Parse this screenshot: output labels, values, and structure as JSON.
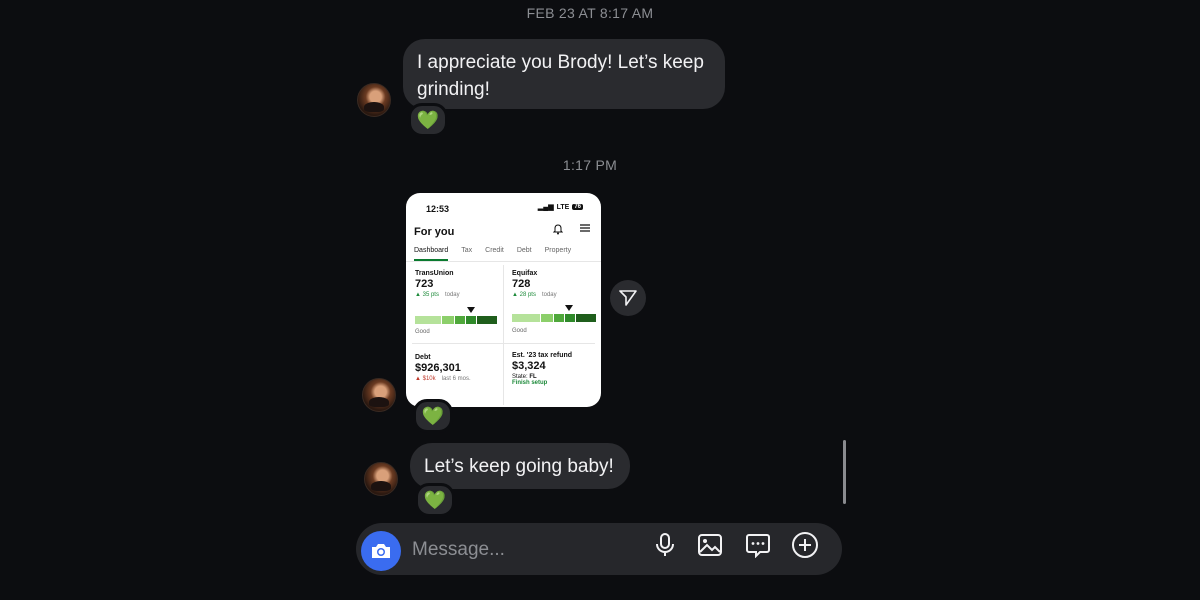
{
  "thread": {
    "timestamp_1": "FEB 23 AT 8:17 AM",
    "message_1": "I appreciate you Brody! Let’s keep grinding!",
    "reaction_1": "💚",
    "timestamp_2": "1:17 PM",
    "reaction_2": "💚",
    "message_3": "Let’s keep going baby!",
    "reaction_3": "💚"
  },
  "shared_screenshot": {
    "status_time": "12:53",
    "status_network": "LTE",
    "status_battery": "76",
    "title": "For you",
    "tabs": [
      "Dashboard",
      "Tax",
      "Credit",
      "Debt",
      "Property"
    ],
    "active_tab": "Dashboard",
    "transunion": {
      "label": "TransUnion",
      "score": "723",
      "change": "▲ 35 pts",
      "period": "today",
      "rating": "Good"
    },
    "equifax": {
      "label": "Equifax",
      "score": "728",
      "change": "▲ 28 pts",
      "period": "today",
      "rating": "Good"
    },
    "debt": {
      "label": "Debt",
      "amount": "$926,301",
      "change": "▲ $10k",
      "period": "last 6 mos."
    },
    "tax": {
      "label": "Est. '23 tax refund",
      "amount": "$3,324",
      "state_label": "State:",
      "state": "FL",
      "cta": "Finish setup"
    }
  },
  "composer": {
    "placeholder": "Message...",
    "icons": [
      "camera-icon",
      "microphone-icon",
      "image-icon",
      "sticker-icon",
      "plus-icon"
    ]
  },
  "colors": {
    "background": "#0c0d10",
    "bubble": "#2a2b2f",
    "camera_button": "#3a6cf0",
    "heart": "#2fbf4a"
  }
}
